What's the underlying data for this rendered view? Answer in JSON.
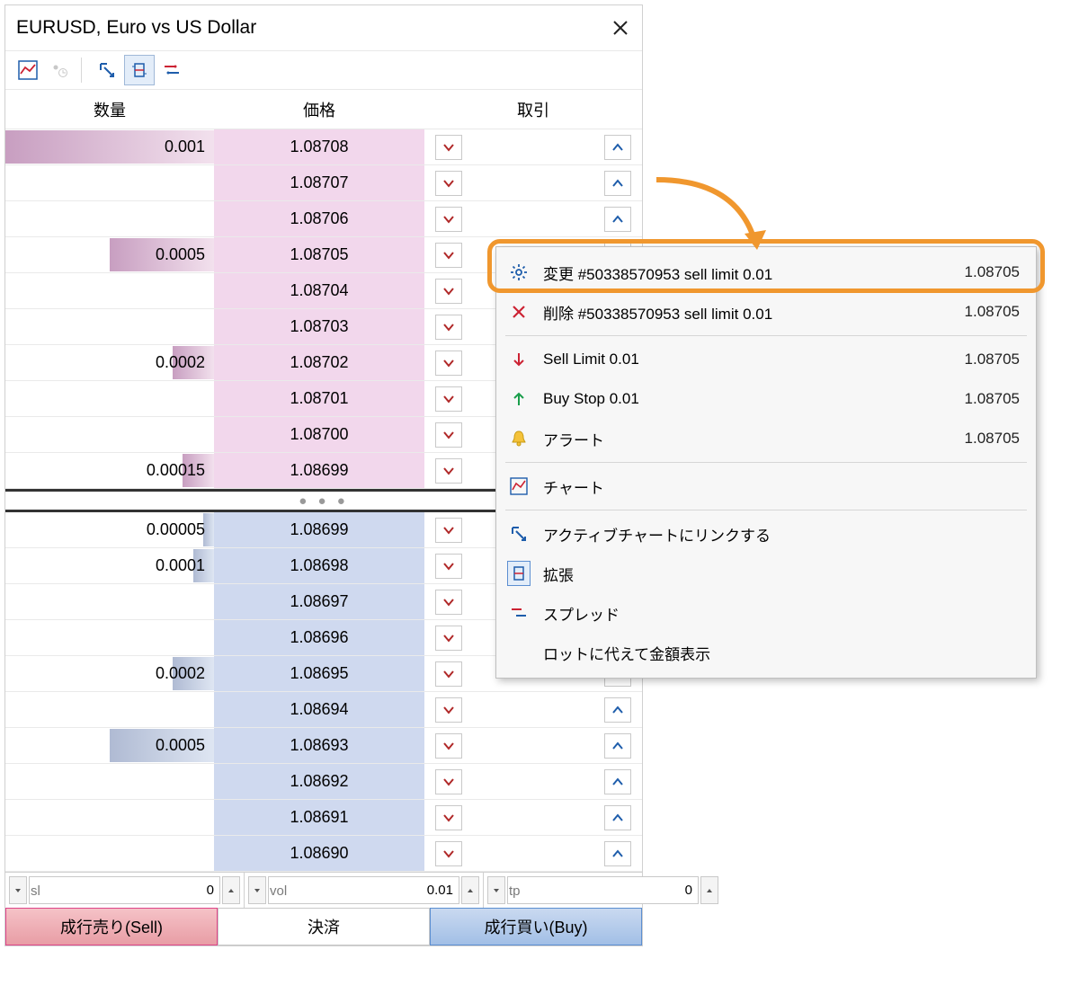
{
  "window": {
    "title": "EURUSD, Euro vs US Dollar"
  },
  "headers": {
    "qty": "数量",
    "price": "価格",
    "trade": "取引"
  },
  "ask_rows": [
    {
      "qty": "0.001",
      "price": "1.08708",
      "bar_pct": 100
    },
    {
      "qty": "",
      "price": "1.08707",
      "bar_pct": 0
    },
    {
      "qty": "",
      "price": "1.08706",
      "bar_pct": 0
    },
    {
      "qty": "0.0005",
      "price": "1.08705",
      "bar_pct": 50
    },
    {
      "qty": "",
      "price": "1.08704",
      "bar_pct": 0
    },
    {
      "qty": "",
      "price": "1.08703",
      "bar_pct": 0
    },
    {
      "qty": "0.0002",
      "price": "1.08702",
      "bar_pct": 20
    },
    {
      "qty": "",
      "price": "1.08701",
      "bar_pct": 0
    },
    {
      "qty": "",
      "price": "1.08700",
      "bar_pct": 0
    },
    {
      "qty": "0.00015",
      "price": "1.08699",
      "bar_pct": 15
    }
  ],
  "bid_rows": [
    {
      "qty": "0.00005",
      "price": "1.08699",
      "bar_pct": 5
    },
    {
      "qty": "0.0001",
      "price": "1.08698",
      "bar_pct": 10
    },
    {
      "qty": "",
      "price": "1.08697",
      "bar_pct": 0
    },
    {
      "qty": "",
      "price": "1.08696",
      "bar_pct": 0
    },
    {
      "qty": "0.0002",
      "price": "1.08695",
      "bar_pct": 20
    },
    {
      "qty": "",
      "price": "1.08694",
      "bar_pct": 0
    },
    {
      "qty": "0.0005",
      "price": "1.08693",
      "bar_pct": 50
    },
    {
      "qty": "",
      "price": "1.08692",
      "bar_pct": 0
    },
    {
      "qty": "",
      "price": "1.08691",
      "bar_pct": 0
    },
    {
      "qty": "",
      "price": "1.08690",
      "bar_pct": 0
    }
  ],
  "inputs": {
    "sl": {
      "label": "sl",
      "value": "0"
    },
    "vol": {
      "label": "vol",
      "value": "0.01"
    },
    "tp": {
      "label": "tp",
      "value": "0"
    }
  },
  "actions": {
    "sell": "成行売り(Sell)",
    "close": "決済",
    "buy": "成行買い(Buy)"
  },
  "ctx": {
    "modify": {
      "label": "変更 #50338570953 sell limit 0.01",
      "value": "1.08705"
    },
    "delete": {
      "label": "削除 #50338570953 sell limit 0.01",
      "value": "1.08705"
    },
    "selllimit": {
      "label": "Sell Limit 0.01",
      "value": "1.08705"
    },
    "buystop": {
      "label": "Buy Stop 0.01",
      "value": "1.08705"
    },
    "alert": {
      "label": "アラート",
      "value": "1.08705"
    },
    "chart": "チャート",
    "link": "アクティブチャートにリンクする",
    "expand": "拡張",
    "spread": "スプレッド",
    "lots": "ロットに代えて金額表示"
  }
}
